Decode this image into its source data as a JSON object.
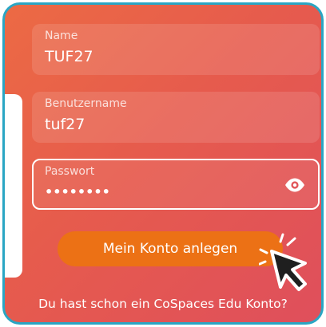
{
  "form": {
    "name": {
      "label": "Name",
      "value": "TUF27"
    },
    "username": {
      "label": "Benutzername",
      "value": "tuf27"
    },
    "password": {
      "label": "Passwort",
      "value": "••••••••",
      "toggle_icon": "eye-icon"
    },
    "submit_label": "Mein Konto anlegen",
    "login_prompt": "Du hast schon ein CoSpaces Edu Konto?"
  },
  "colors": {
    "background_start": "#ec6a44",
    "background_end": "#df4f5c",
    "frame_border": "#2aa6c4",
    "button": "#ec7115",
    "text": "#ffffff"
  },
  "icons": [
    "eye-icon",
    "cursor-icon"
  ]
}
